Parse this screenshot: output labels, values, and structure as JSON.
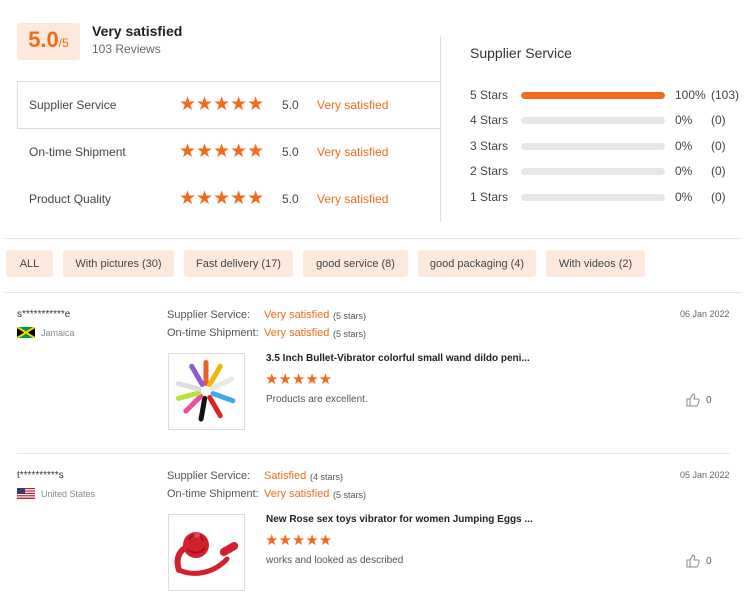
{
  "summary": {
    "score": "5.0",
    "score_suffix": "/5",
    "title": "Very satisfied",
    "reviews": "103 Reviews"
  },
  "ratings": [
    {
      "label": "Supplier Service",
      "stars": "★★★★★",
      "value": "5.0",
      "text": "Very satisfied"
    },
    {
      "label": "On-time Shipment",
      "stars": "★★★★★",
      "value": "5.0",
      "text": "Very satisfied"
    },
    {
      "label": "Product Quality",
      "stars": "★★★★★",
      "value": "5.0",
      "text": "Very satisfied"
    }
  ],
  "distribution": {
    "title": "Supplier Service",
    "rows": [
      {
        "label": "5 Stars",
        "fraction": 1.0,
        "pct": "100%",
        "count": "(103)"
      },
      {
        "label": "4 Stars",
        "fraction": 0,
        "pct": "0%",
        "count": "(0)"
      },
      {
        "label": "3 Stars",
        "fraction": 0,
        "pct": "0%",
        "count": "(0)"
      },
      {
        "label": "2 Stars",
        "fraction": 0,
        "pct": "0%",
        "count": "(0)"
      },
      {
        "label": "1 Stars",
        "fraction": 0,
        "pct": "0%",
        "count": "(0)"
      }
    ]
  },
  "filters": [
    "ALL",
    "With pictures (30)",
    "Fast delivery (17)",
    "good service (8)",
    "good packaging (4)",
    "With videos (2)"
  ],
  "reviews": [
    {
      "user": "s***********e",
      "country": "Jamaica",
      "supplier_label": "Supplier Service:",
      "supplier_value": "Very satisfied",
      "supplier_stars": "(5 stars)",
      "shipment_label": "On-time Shipment:",
      "shipment_value": "Very satisfied",
      "shipment_stars": "(5 stars)",
      "date": "06 Jan 2022",
      "product": "3.5 Inch Bullet-Vibrator colorful small wand dildo peni...",
      "stars": "★★★★★",
      "text": "Products are excellent.",
      "likes": "0"
    },
    {
      "user": "t**********s",
      "country": "United States",
      "supplier_label": "Supplier Service:",
      "supplier_value": "Satisfied",
      "supplier_stars": "(4 stars)",
      "shipment_label": "On-time Shipment:",
      "shipment_value": "Very satisfied",
      "shipment_stars": "(5 stars)",
      "date": "05 Jan 2022",
      "product": "New Rose sex toys vibrator for women Jumping Eggs ...",
      "stars": "★★★★★",
      "text": "works and looked as described",
      "likes": "0"
    }
  ],
  "colors": {
    "accent": "#f26b1d",
    "chip_bg": "#fde8dc"
  }
}
